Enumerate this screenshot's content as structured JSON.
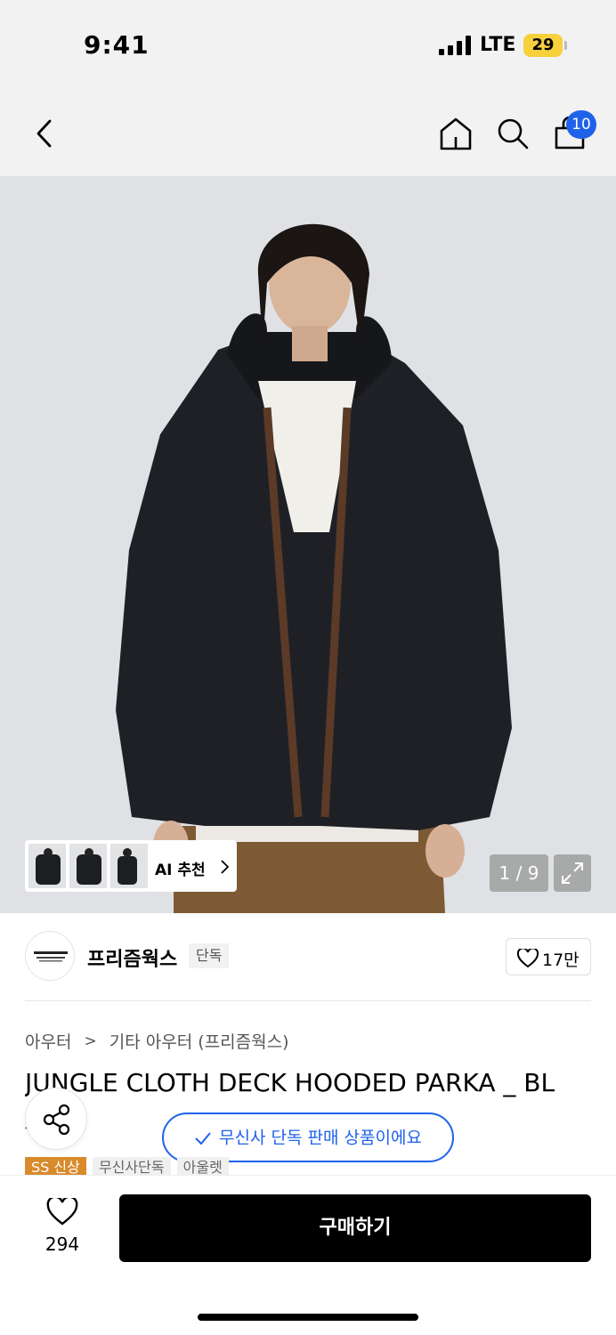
{
  "status_bar": {
    "time": "9:41",
    "network": "LTE",
    "battery": "29"
  },
  "nav": {
    "cart_count": "10"
  },
  "gallery": {
    "ai_recommend_label": "AI 추천",
    "page_indicator": "1 / 9"
  },
  "brand": {
    "name": "프리즘웍스",
    "exclusive_tag": "단독",
    "likes": "17만"
  },
  "breadcrumb": {
    "category": "아우터",
    "separator": ">",
    "subcategory": "기타 아우터 (프리즘웍스)"
  },
  "product": {
    "title": "JUNGLE CLOTH DECK HOODED PARKA _ BL",
    "title_line2": "A"
  },
  "notice": {
    "text": "무신사 단독 판매 상품이에요"
  },
  "tags": [
    "SS 신상",
    "무신사단독",
    "아울렛"
  ],
  "bottom_bar": {
    "wish_count": "294",
    "buy_label": "구매하기"
  },
  "colors": {
    "accent_blue": "#1f62ea",
    "tag_new": "#d98a2b",
    "buy_button": "#000000"
  }
}
